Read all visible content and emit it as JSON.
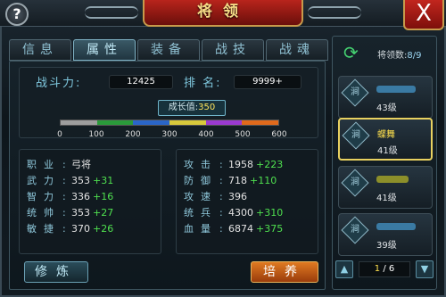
{
  "window": {
    "title": "将领",
    "help_label": "?",
    "close_label": "X"
  },
  "tabs": [
    {
      "label": "信息",
      "active": false
    },
    {
      "label": "属性",
      "active": true
    },
    {
      "label": "装备",
      "active": false
    },
    {
      "label": "战技",
      "active": false
    },
    {
      "label": "战魂",
      "active": false
    }
  ],
  "power": {
    "label": "战斗力:",
    "value": "12425",
    "rank_label": "排 名:",
    "rank_value": "9999+"
  },
  "growth": {
    "label": "成长值:",
    "value": "350",
    "scale_max": 600,
    "ticks": [
      "0",
      "100",
      "200",
      "300",
      "400",
      "500",
      "600"
    ]
  },
  "left_stats": {
    "profession_label": "职业",
    "profession_value": "弓将",
    "rows": [
      {
        "label": "武力",
        "value": "353",
        "bonus": "+31"
      },
      {
        "label": "智力",
        "value": "336",
        "bonus": "+16"
      },
      {
        "label": "统帅",
        "value": "353",
        "bonus": "+27"
      },
      {
        "label": "敏捷",
        "value": "370",
        "bonus": "+26"
      }
    ]
  },
  "right_stats": {
    "rows": [
      {
        "label": "攻击",
        "value": "1958",
        "bonus": "+223"
      },
      {
        "label": "防御",
        "value": "718",
        "bonus": "+110"
      },
      {
        "label": "攻速",
        "value": "396",
        "bonus": ""
      },
      {
        "label": "统兵",
        "value": "4300",
        "bonus": "+310"
      },
      {
        "label": "血量",
        "value": "6874",
        "bonus": "+375"
      }
    ]
  },
  "buttons": {
    "refine": "修炼",
    "train": "培养"
  },
  "generals": {
    "count_label": "将领数:",
    "count_value": "8/9",
    "items": [
      {
        "badge": "涧",
        "name": "",
        "level": "43级",
        "selected": false
      },
      {
        "badge": "涧",
        "name": "蝶舞",
        "level": "41级",
        "selected": true
      },
      {
        "badge": "涧",
        "name": "",
        "level": "41级",
        "selected": false
      },
      {
        "badge": "涧",
        "name": "",
        "level": "39级",
        "selected": false
      }
    ],
    "page_current": "1",
    "page_total": "/ 6"
  },
  "colors": {
    "accent_red": "#b8241c",
    "gold": "#e8d160",
    "bonus_green": "#4fe04f",
    "label_cyan": "#8fc8db"
  }
}
